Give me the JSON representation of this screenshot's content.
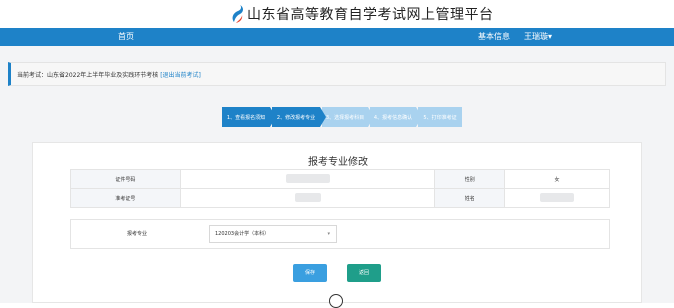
{
  "header": {
    "title": "山东省高等教育自学考试网上管理平台",
    "logo_colors": [
      "#1e82c8",
      "#e8402a"
    ]
  },
  "nav": {
    "home": "首页",
    "info": "基本信息",
    "user": "王瑞璇▾"
  },
  "exam_bar": {
    "prefix": "当前考试：",
    "exam_name": "山东省2022年上半年毕业及实践环节考核",
    "exit_link": "[退出当前考试]"
  },
  "steps": [
    {
      "label": "1、查看报名须知",
      "active": true
    },
    {
      "label": "2、修改报考专业",
      "active": true
    },
    {
      "label": "3、选择报考科目",
      "active": false
    },
    {
      "label": "4、报考信息确认",
      "active": false
    },
    {
      "label": "5、打印准考证",
      "active": false
    }
  ],
  "panel": {
    "title": "报考专业修改",
    "rows": [
      {
        "label1": "证件号码",
        "label2": "性别",
        "value2": "女"
      },
      {
        "label1": "准考证号",
        "label2": "姓名",
        "value2": ""
      }
    ],
    "major": {
      "label": "报考专业",
      "selected": "120203会计学（本科）"
    },
    "save_label": "保存",
    "back_label": "返回"
  }
}
